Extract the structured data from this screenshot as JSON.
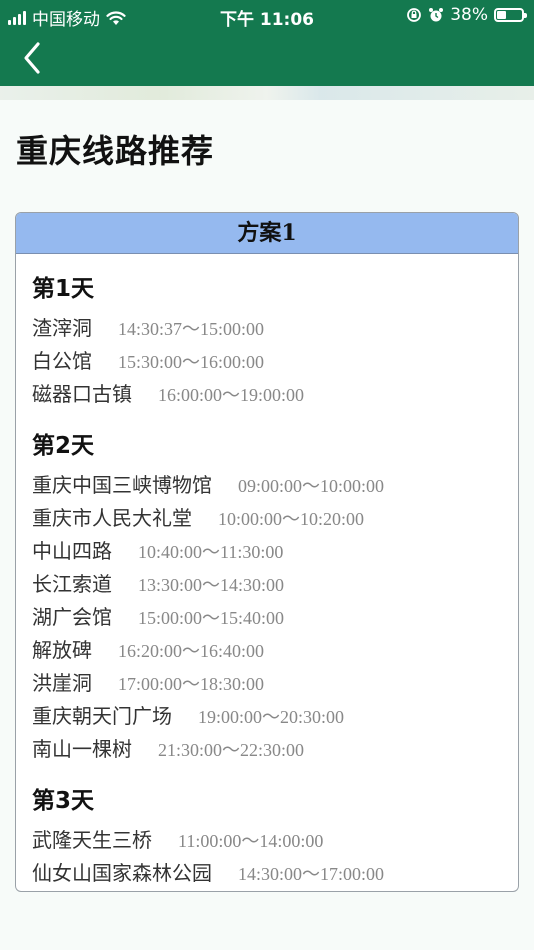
{
  "status": {
    "carrier": "中国移动",
    "time": "下午 11:06",
    "battery_pct": "38%",
    "battery_level": 0.38
  },
  "page": {
    "title": "重庆线路推荐"
  },
  "plan": {
    "title": "方案1",
    "days": [
      {
        "label": "第1天",
        "stops": [
          {
            "name": "渣滓洞",
            "time": "14:30:37～15:00:00"
          },
          {
            "name": "白公馆",
            "time": "15:30:00～16:00:00"
          },
          {
            "name": "磁器口古镇",
            "time": "16:00:00～19:00:00"
          }
        ]
      },
      {
        "label": "第2天",
        "stops": [
          {
            "name": "重庆中国三峡博物馆",
            "time": "09:00:00～10:00:00"
          },
          {
            "name": "重庆市人民大礼堂",
            "time": "10:00:00～10:20:00"
          },
          {
            "name": "中山四路",
            "time": "10:40:00～11:30:00"
          },
          {
            "name": "长江索道",
            "time": "13:30:00～14:30:00"
          },
          {
            "name": "湖广会馆",
            "time": "15:00:00～15:40:00"
          },
          {
            "name": "解放碑",
            "time": "16:20:00～16:40:00"
          },
          {
            "name": "洪崖洞",
            "time": "17:00:00～18:30:00"
          },
          {
            "name": "重庆朝天门广场",
            "time": "19:00:00～20:30:00"
          },
          {
            "name": "南山一棵树",
            "time": "21:30:00～22:30:00"
          }
        ]
      },
      {
        "label": "第3天",
        "stops": [
          {
            "name": "武隆天生三桥",
            "time": "11:00:00～14:00:00"
          },
          {
            "name": "仙女山国家森林公园",
            "time": "14:30:00～17:00:00"
          }
        ]
      }
    ]
  },
  "colors": {
    "header_bg": "#14794f",
    "plan_header_bg": "#95b9ef"
  },
  "icons": [
    "signal-bars-icon",
    "wifi-icon",
    "rotation-lock-icon",
    "alarm-icon",
    "battery-icon",
    "back-chevron-icon"
  ]
}
